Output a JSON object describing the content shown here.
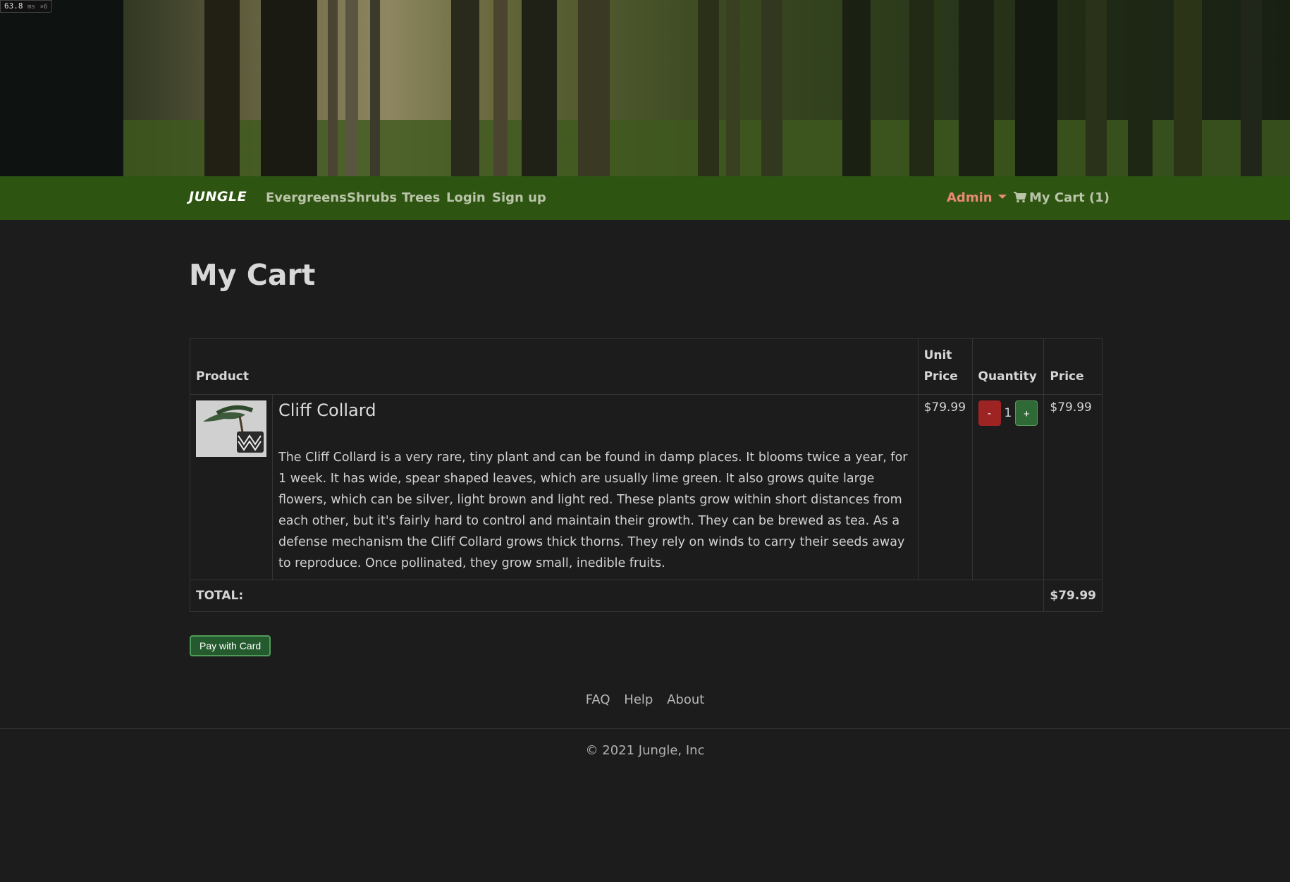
{
  "perf": {
    "value": "63.8",
    "unit": "ms",
    "multiplier": "×6"
  },
  "nav": {
    "brand": "JUNGLE",
    "links": [
      "Evergreens",
      "Shrubs",
      "Trees",
      "Login",
      "Sign up"
    ],
    "admin": "Admin",
    "cart": "My Cart (1)"
  },
  "page": {
    "title": "My Cart"
  },
  "table": {
    "headers": {
      "product": "Product",
      "unit_price": "Unit Price",
      "quantity": "Quantity",
      "price": "Price"
    },
    "rows": [
      {
        "name": "Cliff Collard",
        "description": "The Cliff Collard is a very rare, tiny plant and can be found in damp places. It blooms twice a year, for 1 week. It has wide, spear shaped leaves, which are usually lime green. It also grows quite large flowers, which can be silver, light brown and light red. These plants grow within short distances from each other, but it's fairly hard to control and maintain their growth. They can be brewed as tea. As a defense mechanism the Cliff Collard grows thick thorns. They rely on winds to carry their seeds away to reproduce. Once pollinated, they grow small, inedible fruits.",
        "unit_price": "$79.99",
        "quantity": "1",
        "minus": "-",
        "plus": "+",
        "price": "$79.99"
      }
    ],
    "total_label": "TOTAL:",
    "total_value": "$79.99"
  },
  "checkout": {
    "pay_label": "Pay with Card"
  },
  "footer": {
    "links": [
      "FAQ",
      "Help",
      "About"
    ],
    "copyright": "© 2021 Jungle, Inc"
  },
  "colors": {
    "navbar": "#2e5412",
    "background": "#1b1c1b",
    "admin": "#e98b72",
    "minus": "#9e2424",
    "plus": "#2f6a36"
  }
}
